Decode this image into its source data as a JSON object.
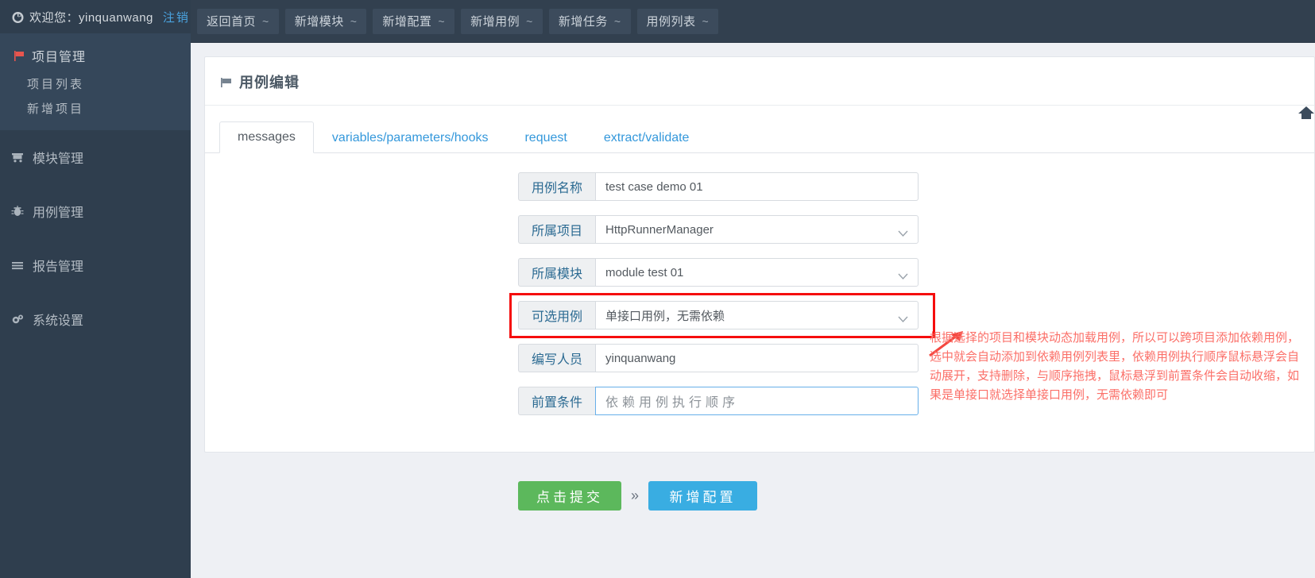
{
  "sidebar": {
    "welcome": {
      "icon": "gauge-icon",
      "text": "欢迎您：yinquanwang",
      "logout_label": "注销"
    },
    "project_group": {
      "icon": "flag-icon",
      "label": "项目管理",
      "items": [
        {
          "label": "项目列表"
        },
        {
          "label": "新增项目"
        }
      ]
    },
    "nav_items": [
      {
        "icon": "cart-icon",
        "label": "模块管理"
      },
      {
        "icon": "bug-icon",
        "label": "用例管理"
      },
      {
        "icon": "list-icon",
        "label": "报告管理"
      },
      {
        "icon": "gears-icon",
        "label": "系统设置"
      }
    ]
  },
  "topnav": {
    "tilde": "~",
    "items": [
      {
        "label": "返回首页"
      },
      {
        "label": "新增模块"
      },
      {
        "label": "新增配置"
      },
      {
        "label": "新增用例"
      },
      {
        "label": "新增任务"
      },
      {
        "label": "用例列表"
      }
    ]
  },
  "panel": {
    "icon": "flag-icon",
    "title": "用例编辑",
    "tabs": [
      {
        "label": "messages",
        "active": true
      },
      {
        "label": "variables/parameters/hooks",
        "active": false
      },
      {
        "label": "request",
        "active": false
      },
      {
        "label": "extract/validate",
        "active": false
      }
    ],
    "fields": [
      {
        "label": "用例名称",
        "value": "test case demo 01",
        "type": "text",
        "highlight": false,
        "focused": false
      },
      {
        "label": "所属项目",
        "value": "HttpRunnerManager",
        "type": "select",
        "highlight": false,
        "focused": false
      },
      {
        "label": "所属模块",
        "value": "module test 01",
        "type": "select",
        "highlight": false,
        "focused": false
      },
      {
        "label": "可选用例",
        "value": "单接口用例，无需依赖",
        "type": "select",
        "highlight": true,
        "focused": false
      },
      {
        "label": "编写人员",
        "value": "yinquanwang",
        "type": "text",
        "highlight": false,
        "focused": false
      },
      {
        "label": "前置条件",
        "value": "",
        "placeholder": "依赖用例执行顺序",
        "type": "text",
        "highlight": false,
        "focused": true
      }
    ]
  },
  "annotation": {
    "color": "#fb6f68",
    "lines": [
      "根据选择的项目和模块动态加载用例，所以可以跨项目添加依赖用例，",
      "选中就会自动添加到依赖用例列表里，依赖用例执行顺序鼠标悬浮会自",
      "动展开，支持删除，与顺序拖拽，鼠标悬浮到前置条件会自动收缩，如",
      "果是单接口就选择单接口用例，无需依赖即可"
    ]
  },
  "footer": {
    "submit_label": "点击提交",
    "separator": "»",
    "next_label": "新增配置"
  },
  "colors": {
    "sidebar_bg": "#2f3e4e",
    "topnav_bg": "#32404f",
    "content_bg": "#eef0f4",
    "link": "#3498db",
    "label_text": "#2b6a92",
    "highlight_border": "#f50d0d",
    "submit_green": "#5cb85c",
    "next_blue": "#39ade2",
    "annotation_red": "#fb6f68"
  }
}
